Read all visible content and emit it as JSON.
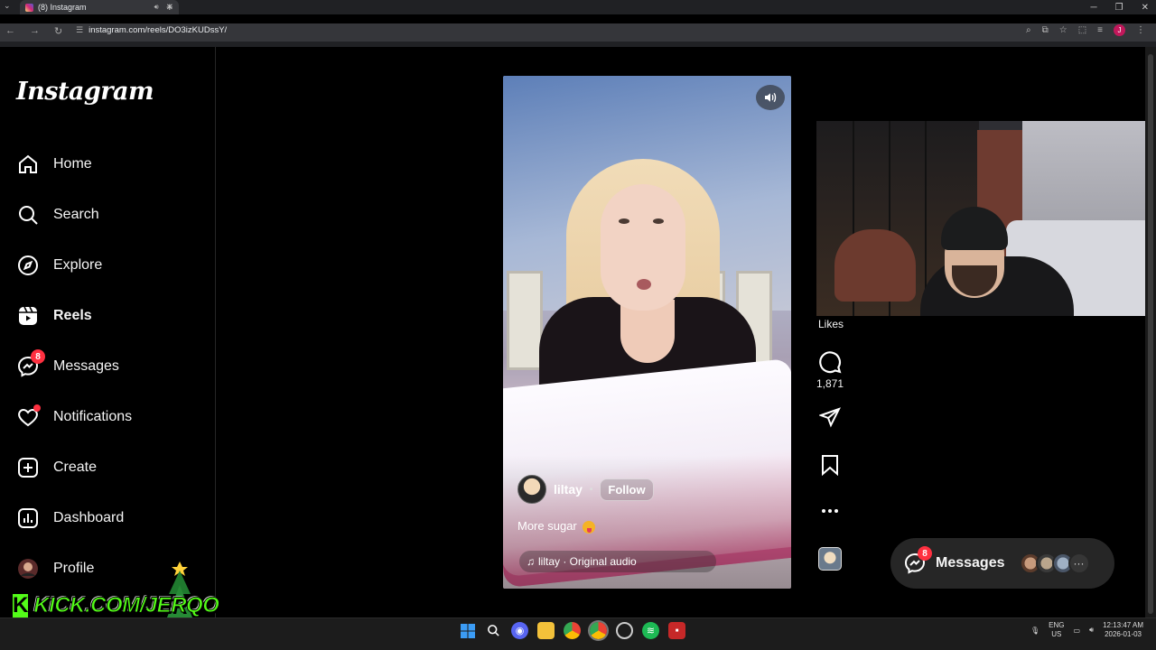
{
  "browser": {
    "tab_title": "(8) Instagram",
    "url": "instagram.com/reels/DO3izKUDssY/"
  },
  "sidebar": {
    "logo": "Instagram",
    "items": [
      {
        "label": "Home",
        "icon": "home-icon"
      },
      {
        "label": "Search",
        "icon": "search-icon"
      },
      {
        "label": "Explore",
        "icon": "compass-icon"
      },
      {
        "label": "Reels",
        "icon": "reels-icon",
        "active": true
      },
      {
        "label": "Messages",
        "icon": "messenger-icon",
        "badge": "8"
      },
      {
        "label": "Notifications",
        "icon": "heart-icon"
      },
      {
        "label": "Create",
        "icon": "plus-square-icon"
      },
      {
        "label": "Dashboard",
        "icon": "dashboard-icon"
      },
      {
        "label": "Profile",
        "icon": "profile-avatar"
      }
    ]
  },
  "overlay": {
    "kick_text": "KICK.COM/JERQO"
  },
  "reel": {
    "username": "liltay",
    "separator": "•",
    "follow_label": "Follow",
    "caption": "More sugar",
    "audio": "liltay · Original audio"
  },
  "actions": {
    "likes_label": "Likes",
    "comment_count": "1,871"
  },
  "messages_pill": {
    "label": "Messages",
    "badge": "8"
  },
  "taskbar": {
    "lang_top": "ENG",
    "lang_bottom": "US",
    "time": "12:13:47 AM",
    "date": "2026-01-03"
  },
  "colors": {
    "background": "#000000",
    "notification_red": "#ff3040",
    "kick_green": "#53fc18",
    "pill_bg": "#262626"
  }
}
